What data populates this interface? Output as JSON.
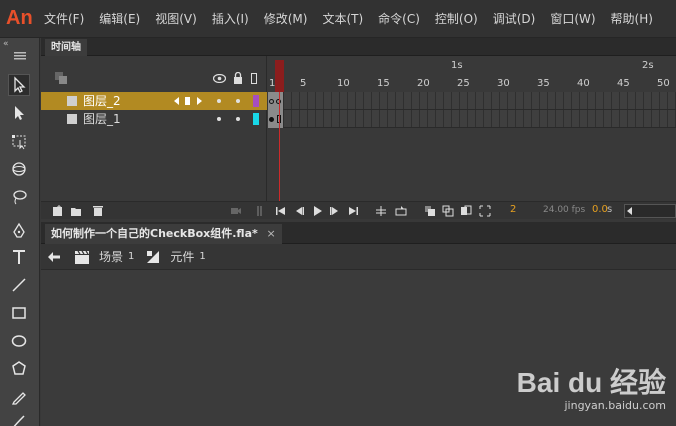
{
  "app": {
    "logo": "An"
  },
  "menu": [
    "文件(F)",
    "编辑(E)",
    "视图(V)",
    "插入(I)",
    "修改(M)",
    "文本(T)",
    "命令(C)",
    "控制(O)",
    "调试(D)",
    "窗口(W)",
    "帮助(H)"
  ],
  "timeline": {
    "tab": "时间轴",
    "layers": [
      {
        "name": "图层_2",
        "selected": true,
        "color": "#a64dc0"
      },
      {
        "name": "图层_1",
        "selected": false,
        "color": "#18d8e8"
      }
    ],
    "ruler": {
      "frames": [
        "1",
        "5",
        "10",
        "15",
        "20",
        "25",
        "30",
        "35",
        "40",
        "45",
        "50"
      ],
      "seconds": [
        "1s",
        "2s"
      ]
    },
    "current_frame": "2",
    "fps": "24.00 fps",
    "elapsed": "0.0",
    "elapsed_unit": "s"
  },
  "document": {
    "tab": "如何制作一个自己的CheckBox组件.fla*",
    "close": "×"
  },
  "breadcrumb": [
    {
      "label": "场景",
      "num": "1"
    },
    {
      "label": "元件",
      "num": "1"
    }
  ],
  "watermark": {
    "brand": "Bai du 经验",
    "url": "jingyan.baidu.com"
  }
}
